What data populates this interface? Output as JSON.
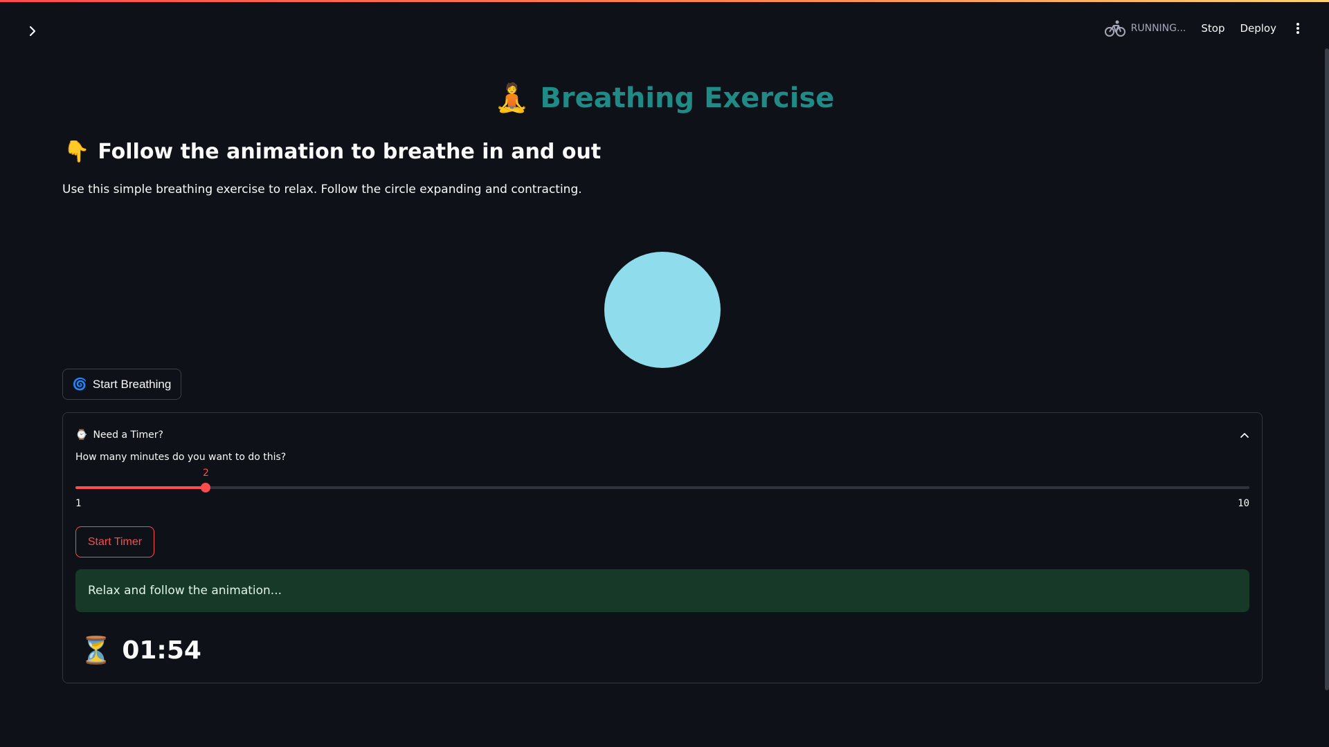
{
  "header": {
    "status_text": "RUNNING...",
    "stop_label": "Stop",
    "deploy_label": "Deploy"
  },
  "page": {
    "title_emoji": "🧘",
    "title": "Breathing Exercise",
    "subheading_emoji": "👇",
    "subheading": "Follow the animation to breathe in and out",
    "intro": "Use this simple breathing exercise to relax. Follow the circle expanding and contracting."
  },
  "breathing": {
    "button_emoji": "🌀",
    "button_label": "Start Breathing",
    "circle_color": "#8fdcec"
  },
  "timer": {
    "expander_emoji": "⌚",
    "expander_label": "Need a Timer?",
    "expanded": true,
    "slider_label": "How many minutes do you want to do this?",
    "slider_min": "1",
    "slider_max": "10",
    "slider_value": "2",
    "start_label": "Start Timer",
    "alert_text": "Relax and follow the animation...",
    "countdown_emoji": "⏳",
    "countdown_text": "01:54"
  },
  "colors": {
    "accent": "#ff4b4b",
    "title": "#1f8a86",
    "background": "#0e1117",
    "success_bg": "#173928"
  }
}
